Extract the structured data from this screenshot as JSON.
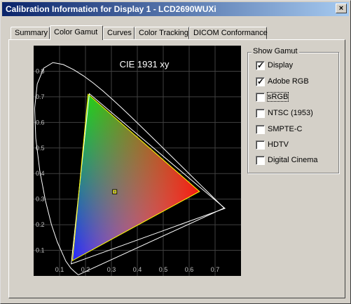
{
  "window": {
    "title": "Calibration Information for Display 1 - LCD2690WUXi",
    "close_glyph": "×"
  },
  "tabs": [
    "Summary",
    "Color Gamut",
    "Curves",
    "Color Tracking",
    "DICOM Conformance"
  ],
  "active_tab": "Color Gamut",
  "show_gamut": {
    "legend": "Show Gamut",
    "options": [
      {
        "label": "Display",
        "checked": true
      },
      {
        "label": "Adobe RGB",
        "checked": true
      },
      {
        "label": "sRGB",
        "checked": false
      },
      {
        "label": "NTSC (1953)",
        "checked": false
      },
      {
        "label": "SMPTE-C",
        "checked": false
      },
      {
        "label": "HDTV",
        "checked": false
      },
      {
        "label": "Digital Cinema",
        "checked": false
      }
    ]
  },
  "chart_data": {
    "type": "scatter",
    "title": "CIE 1931 xy",
    "xlim": [
      0,
      0.8
    ],
    "ylim": [
      0,
      0.9
    ],
    "x_ticks": [
      "0.1",
      "0.2",
      "0.3",
      "0.4",
      "0.5",
      "0.6",
      "0.7"
    ],
    "y_ticks": [
      "0.1",
      "0.2",
      "0.3",
      "0.4",
      "0.5",
      "0.6",
      "0.7",
      "0.8"
    ],
    "grid": true,
    "background": "#000000",
    "colors": {
      "locus": "#ffffff",
      "display": "#ffffff",
      "adobe_rgb": "#ffff00",
      "grid": "#404040",
      "tick_label": "#c0c0c0"
    },
    "spectral_locus": [
      [
        0.1741,
        0.005
      ],
      [
        0.1738,
        0.0049
      ],
      [
        0.1733,
        0.0048
      ],
      [
        0.1726,
        0.0048
      ],
      [
        0.1714,
        0.0051
      ],
      [
        0.1689,
        0.0069
      ],
      [
        0.1644,
        0.0109
      ],
      [
        0.1566,
        0.0177
      ],
      [
        0.144,
        0.0297
      ],
      [
        0.1241,
        0.0578
      ],
      [
        0.0913,
        0.1327
      ],
      [
        0.0687,
        0.2007
      ],
      [
        0.0454,
        0.295
      ],
      [
        0.0235,
        0.4127
      ],
      [
        0.0082,
        0.5384
      ],
      [
        0.0039,
        0.6548
      ],
      [
        0.0139,
        0.7502
      ],
      [
        0.0389,
        0.812
      ],
      [
        0.0743,
        0.8338
      ],
      [
        0.1142,
        0.8262
      ],
      [
        0.1547,
        0.8059
      ],
      [
        0.1929,
        0.7816
      ],
      [
        0.2296,
        0.7543
      ],
      [
        0.2658,
        0.7243
      ],
      [
        0.3016,
        0.6923
      ],
      [
        0.3373,
        0.6589
      ],
      [
        0.3731,
        0.6245
      ],
      [
        0.4087,
        0.5896
      ],
      [
        0.4441,
        0.5547
      ],
      [
        0.4788,
        0.5202
      ],
      [
        0.5125,
        0.4866
      ],
      [
        0.5448,
        0.4544
      ],
      [
        0.5752,
        0.4242
      ],
      [
        0.6029,
        0.3965
      ],
      [
        0.627,
        0.3725
      ],
      [
        0.6482,
        0.3514
      ],
      [
        0.6658,
        0.334
      ],
      [
        0.6801,
        0.3197
      ],
      [
        0.6915,
        0.3083
      ],
      [
        0.7006,
        0.2993
      ],
      [
        0.7079,
        0.292
      ],
      [
        0.714,
        0.2859
      ],
      [
        0.719,
        0.2809
      ],
      [
        0.723,
        0.277
      ],
      [
        0.726,
        0.274
      ],
      [
        0.7283,
        0.2717
      ],
      [
        0.73,
        0.27
      ],
      [
        0.7347,
        0.2653
      ]
    ],
    "series": [
      {
        "name": "Display",
        "points": [
          [
            0.738,
            0.264
          ],
          [
            0.215,
            0.712
          ],
          [
            0.145,
            0.047
          ]
        ]
      },
      {
        "name": "Adobe RGB",
        "points": [
          [
            0.64,
            0.33
          ],
          [
            0.21,
            0.71
          ],
          [
            0.15,
            0.06
          ]
        ]
      }
    ],
    "white_point": [
      0.3127,
      0.329
    ]
  }
}
